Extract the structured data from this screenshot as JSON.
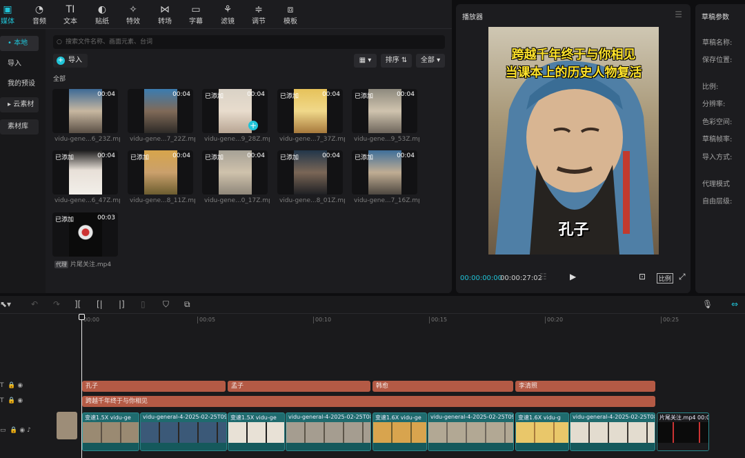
{
  "toolbar": {
    "items": [
      {
        "label": "媒体",
        "icon": "media-icon"
      },
      {
        "label": "音频",
        "icon": "audio-icon"
      },
      {
        "label": "文本",
        "icon": "text-icon"
      },
      {
        "label": "贴纸",
        "icon": "sticker-icon"
      },
      {
        "label": "特效",
        "icon": "effects-icon"
      },
      {
        "label": "转场",
        "icon": "transition-icon"
      },
      {
        "label": "字幕",
        "icon": "subtitle-icon"
      },
      {
        "label": "滤镜",
        "icon": "filter-icon"
      },
      {
        "label": "调节",
        "icon": "adjust-icon"
      },
      {
        "label": "模板",
        "icon": "template-icon"
      }
    ]
  },
  "sidebar": {
    "items": [
      {
        "label": "本地"
      },
      {
        "label": "导入"
      },
      {
        "label": "我的预设"
      },
      {
        "label": "云素材"
      },
      {
        "label": "素材库"
      }
    ]
  },
  "media": {
    "search_placeholder": "搜索文件名称、画面元素、台词",
    "import_label": "导入",
    "sort_label": "排序",
    "filter_label": "全部",
    "section": "全部",
    "added_label": "已添加",
    "proxy_tag": "代理",
    "items": [
      {
        "name": "vidu-gene...6_23Z.mp4",
        "duration": "00:04",
        "added": false
      },
      {
        "name": "vidu-gene...7_22Z.mp4",
        "duration": "00:04",
        "added": false
      },
      {
        "name": "vidu-gene...9_28Z.mp4",
        "duration": "00:04",
        "added": true
      },
      {
        "name": "vidu-gene...7_37Z.mp4",
        "duration": "00:04",
        "added": true
      },
      {
        "name": "vidu-gene...9_53Z.mp4",
        "duration": "00:04",
        "added": true
      },
      {
        "name": "vidu-gene...6_47Z.mp4",
        "duration": "00:04",
        "added": true
      },
      {
        "name": "vidu-gene...8_11Z.mp4",
        "duration": "00:04",
        "added": true
      },
      {
        "name": "vidu-gene...0_17Z.mp4",
        "duration": "00:04",
        "added": true
      },
      {
        "name": "vidu-gene...8_01Z.mp4",
        "duration": "00:04",
        "added": true
      },
      {
        "name": "vidu-gene...7_16Z.mp4",
        "duration": "00:04",
        "added": true
      },
      {
        "name": "片尾关注.mp4",
        "duration": "00:03",
        "added": true
      }
    ]
  },
  "player": {
    "title": "播放器",
    "caption_line1": "跨越千年终于与你相见",
    "caption_line2": "当课本上的历史人物复活",
    "caption_name": "孔子",
    "current_time": "00:00:00:00",
    "total_time": "00:00:27:02",
    "ratio_label": "比例"
  },
  "properties": {
    "title": "草稿参数",
    "fields": [
      "草稿名称:",
      "保存位置:",
      "比例:",
      "分辨率:",
      "色彩空间:",
      "草稿帧率:",
      "导入方式:",
      "代理模式",
      "自由层级:"
    ]
  },
  "timeline": {
    "ticks": [
      "00:00",
      "00:05",
      "00:10",
      "00:15",
      "00:20",
      "00:25"
    ],
    "text_track_1": [
      "孔子",
      "孟子",
      "韩愈",
      "李清照"
    ],
    "text_track_2": "跨越千年终于与你相见",
    "video_clips": [
      {
        "label": "变速1.5X  vidu-ge"
      },
      {
        "label": "vidu-general-4-2025-02-25T09"
      },
      {
        "label": "变速1.5X  vidu-ge"
      },
      {
        "label": "vidu-general-4-2025-02-25T08"
      },
      {
        "label": "变速1.6X  vidu-ge"
      },
      {
        "label": "vidu-general-4-2025-02-25T09"
      },
      {
        "label": "变速1.6X  vidu-g"
      },
      {
        "label": "vidu-general-4-2025-02-25T08"
      },
      {
        "label": "片尾关注.mp4  00:0"
      }
    ]
  },
  "colors": {
    "accent": "#20c4d8",
    "text_clip": "#b45a45",
    "video_clip": "#1f6b6e"
  }
}
